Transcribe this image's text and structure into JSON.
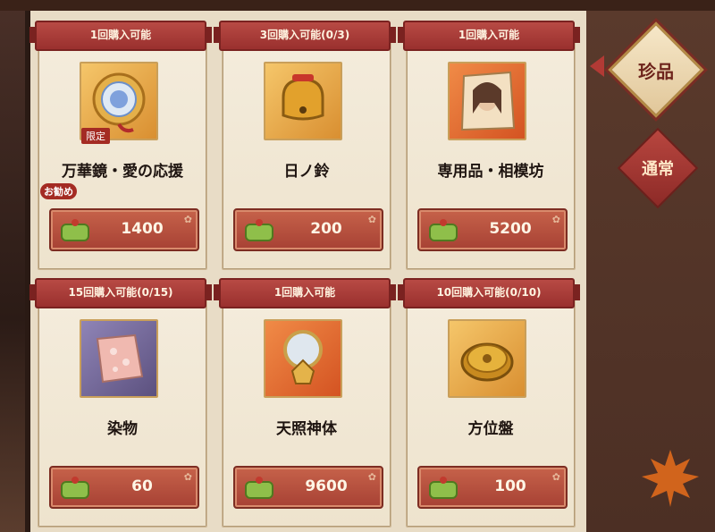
{
  "side_tabs": {
    "active_label": "珍品",
    "inactive_label": "通常"
  },
  "cards": [
    {
      "limit_label": "1回購入可能",
      "name": "万華鏡・愛の応援",
      "price": "1400",
      "limited_badge": "限定",
      "recommend_badge": "お勧め",
      "art": "kaleidoscope-mirror-icon",
      "frame": "gold"
    },
    {
      "limit_label": "3回購入可能(0/3)",
      "name": "日ノ鈴",
      "price": "200",
      "art": "golden-bell-icon",
      "frame": "gold"
    },
    {
      "limit_label": "1回購入可能",
      "name": "専用品・相模坊",
      "price": "5200",
      "art": "portrait-card-icon",
      "frame": "orange"
    },
    {
      "limit_label": "15回購入可能(0/15)",
      "name": "染物",
      "price": "60",
      "art": "dyed-cloth-icon",
      "frame": "purple"
    },
    {
      "limit_label": "1回購入可能",
      "name": "天照神体",
      "price": "9600",
      "art": "sacred-mirror-icon",
      "frame": "orange"
    },
    {
      "limit_label": "10回購入可能(0/10)",
      "name": "方位盤",
      "price": "100",
      "art": "compass-disc-icon",
      "frame": "gold"
    }
  ],
  "currency_icon": "green-coin-pouch-icon",
  "colors": {
    "tab_red": "#9a302e",
    "price_red": "#a74134",
    "card_cream": "#f4ecdc",
    "active_tab_text": "#6d231b"
  }
}
